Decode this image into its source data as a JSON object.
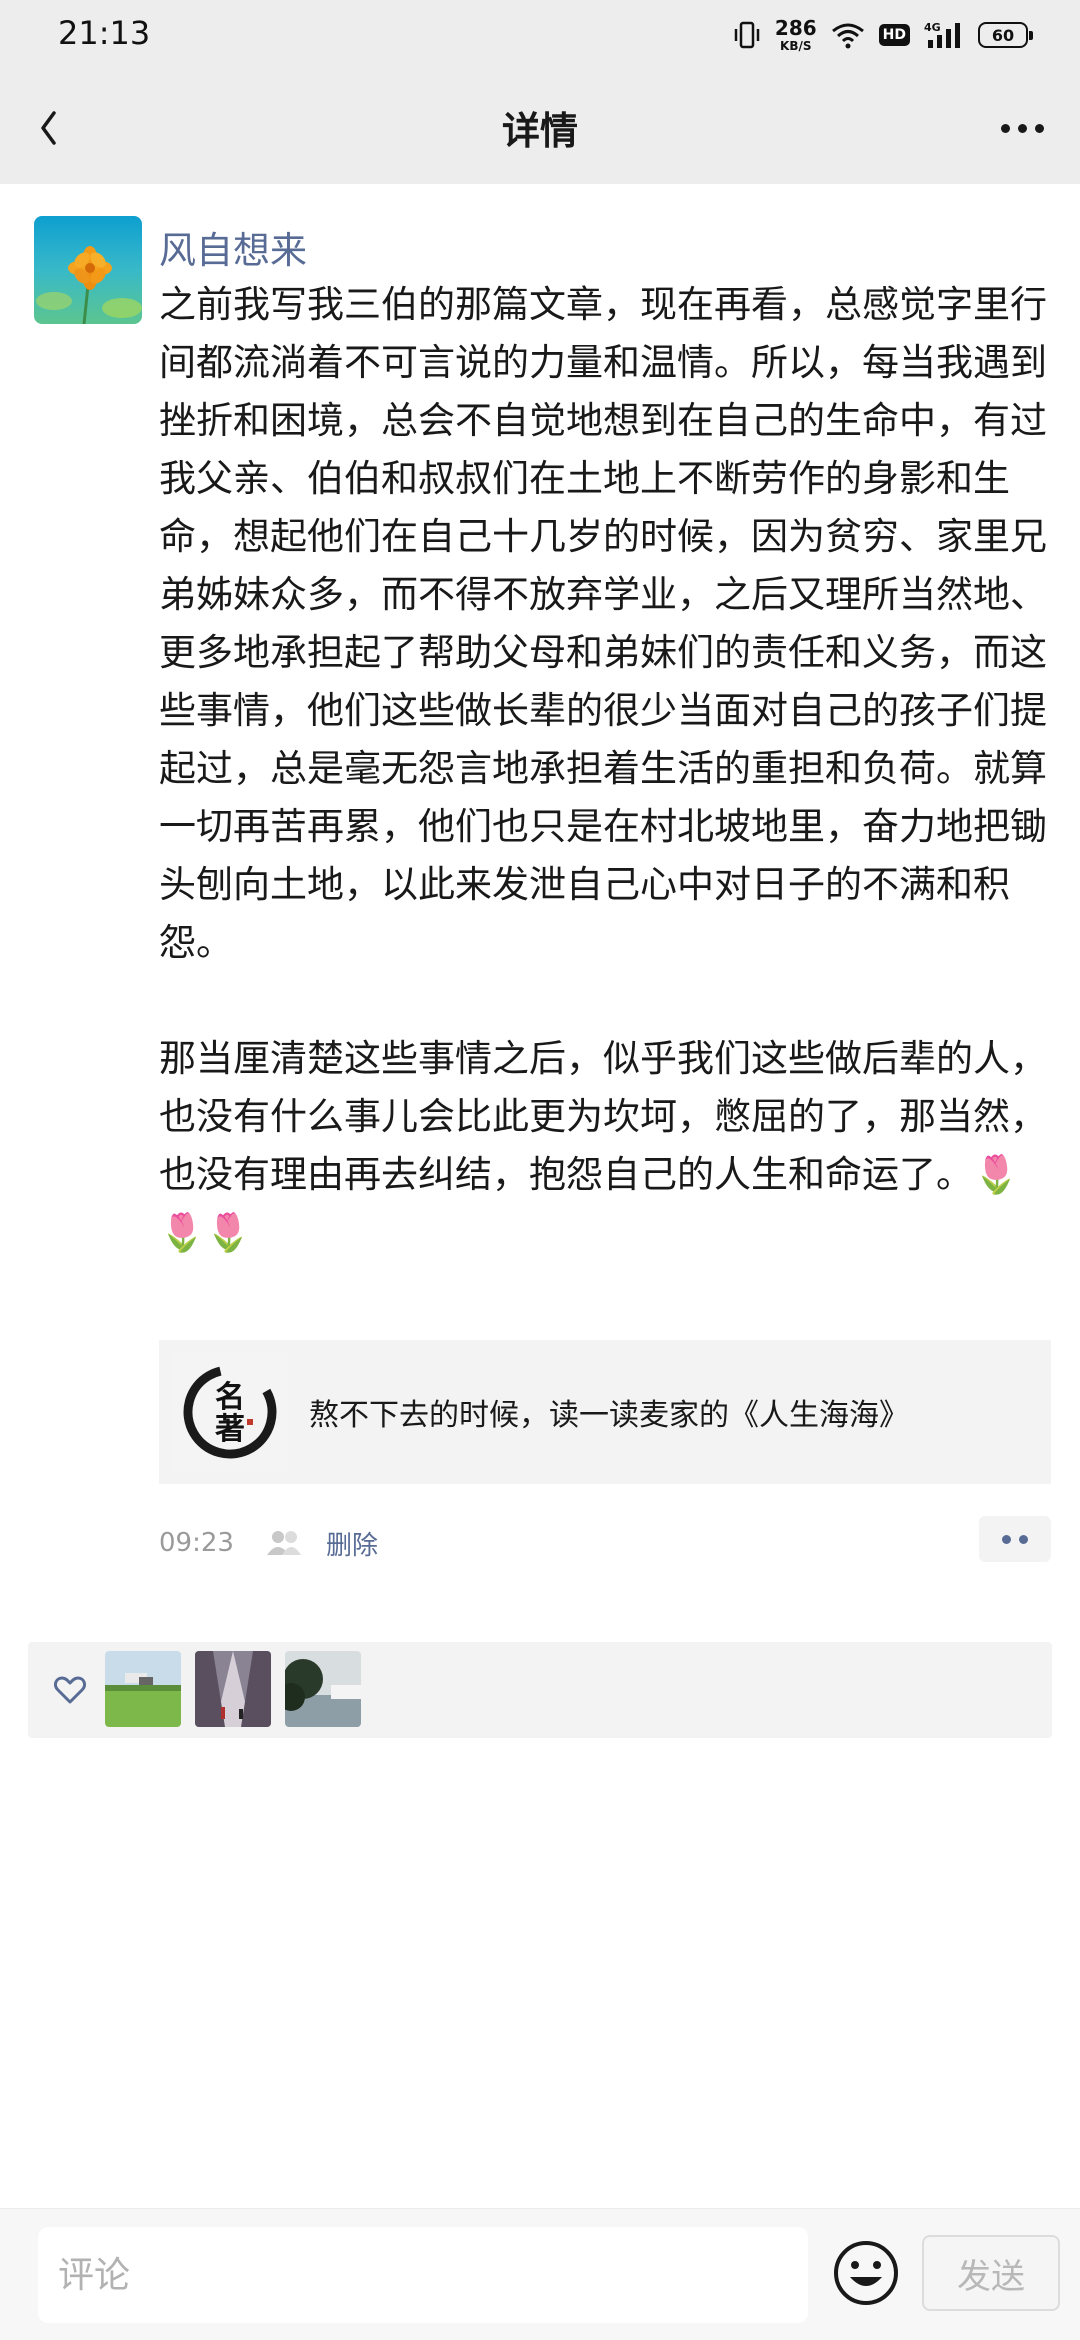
{
  "status_bar": {
    "time": "21:13",
    "net_speed_value": "286",
    "net_speed_unit": "KB/S",
    "hd_label": "HD",
    "signal_label": "4G",
    "battery": "60"
  },
  "nav": {
    "title": "详情",
    "back_icon": "chevron-left-icon",
    "more_icon": "more-dots-icon"
  },
  "post": {
    "author": "风自想来",
    "paragraph1": "之前我写我三伯的那篇文章，现在再看，总感觉字里行间都流淌着不可言说的力量和温情。所以，每当我遇到挫折和困境，总会不自觉地想到在自己的生命中，有过我父亲、伯伯和叔叔们在土地上不断劳作的身影和生命，想起他们在自己十几岁的时候，因为贫穷、家里兄弟姊妹众多，而不得不放弃学业，之后又理所当然地、更多地承担起了帮助父母和弟妹们的责任和义务，而这些事情，他们这些做长辈的很少当面对自己的孩子们提起过，总是毫无怨言地承担着生活的重担和负荷。就算一切再苦再累，他们也只是在村北坡地里，奋力地把锄头刨向土地，以此来发泄自己心中对日子的不满和积怨。",
    "paragraph2": "那当厘清楚这些事情之后，似乎我们这些做后辈的人，也没有什么事儿会比此更为坎坷，憋屈的了，那当然，也没有理由再去纠结，抱怨自己的人生和命运了。",
    "emoji": "🌷🌷🌷",
    "link": {
      "thumb_text": "名著",
      "title": "熬不下去的时候，读一读麦家的《人生海海》"
    },
    "time": "09:23",
    "delete_label": "删除"
  },
  "likes": {
    "icon": "heart-icon",
    "count_shown": 3
  },
  "comment_bar": {
    "placeholder": "评论",
    "send_label": "发送",
    "emoji_icon": "smiley-icon"
  },
  "colors": {
    "link_blue": "#576b95",
    "bar_gray": "#ededed"
  }
}
